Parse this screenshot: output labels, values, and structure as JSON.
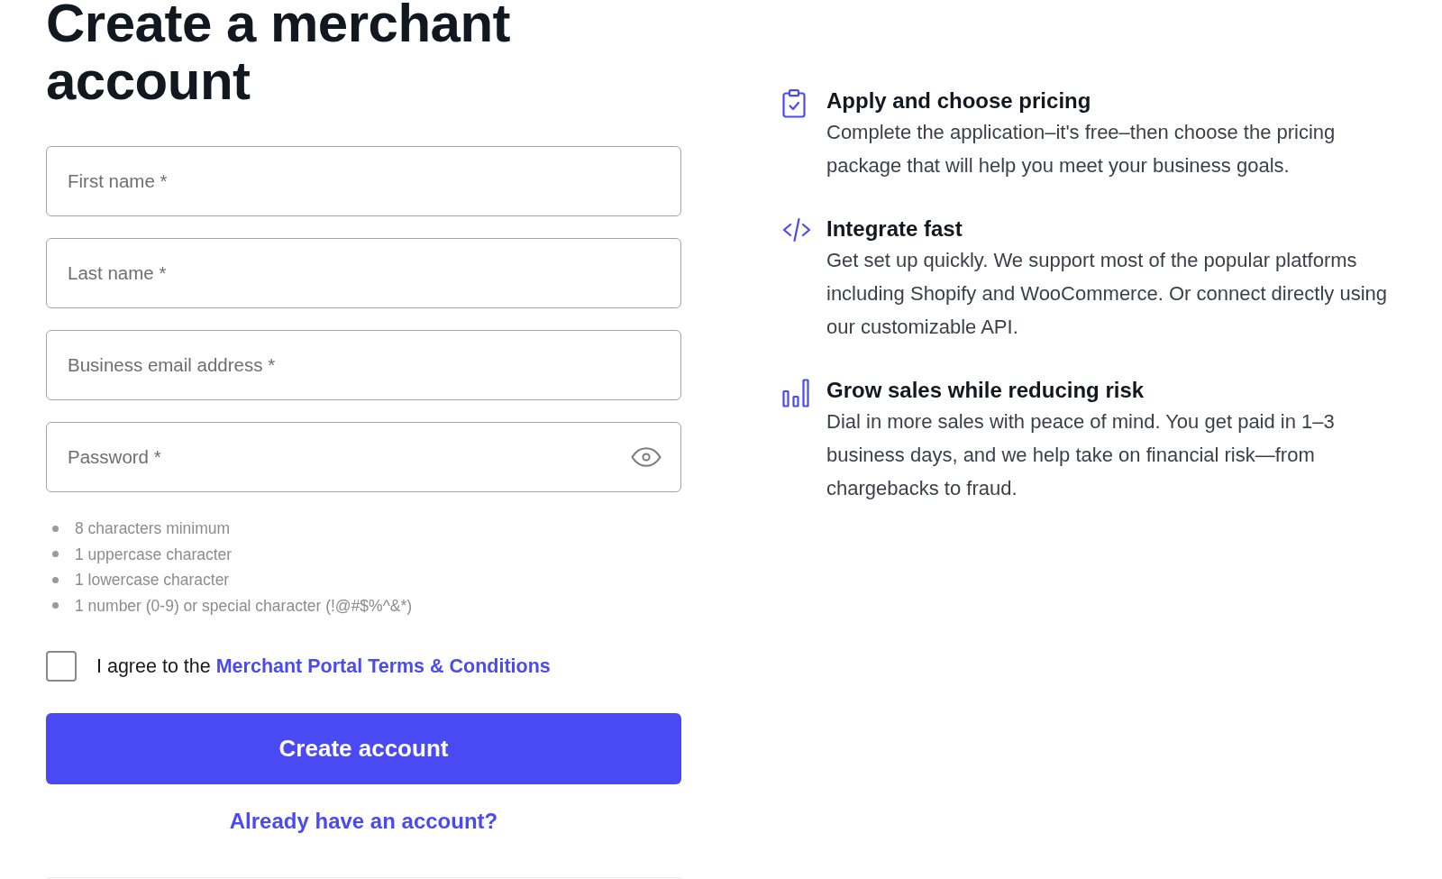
{
  "heading": "Create a merchant account",
  "form": {
    "fields": [
      {
        "kind": "text",
        "placeholder": "First name *"
      },
      {
        "kind": "text",
        "placeholder": "Last name *"
      },
      {
        "kind": "text",
        "placeholder": "Business email address *"
      },
      {
        "kind": "password",
        "placeholder": "Password *"
      }
    ],
    "password_rules": [
      "8 characters minimum",
      "1 uppercase character",
      "1 lowercase character",
      "1 number (0-9) or special character (!@#$%^&*)"
    ],
    "terms": {
      "checked": false,
      "text": "I agree to the",
      "link": "Merchant Portal Terms & Conditions"
    },
    "submit_button": "Create account",
    "signin_link": "Already have an account?"
  },
  "features": [
    {
      "title": "Apply and choose pricing",
      "text": "Complete the application–it's free–then choose the pricing package that will help you meet your business goals."
    },
    {
      "title": "Integrate fast",
      "text": "Get set up quickly. We support most of the popular platforms including Shopify and WooCommerce. Or connect directly using our customizable API."
    },
    {
      "title": "Grow sales while reducing risk",
      "text": "Dial in more sales with peace of mind. You get paid in 1–3 business days, and we help take on financial risk—from chargebacks to fraud."
    }
  ]
}
